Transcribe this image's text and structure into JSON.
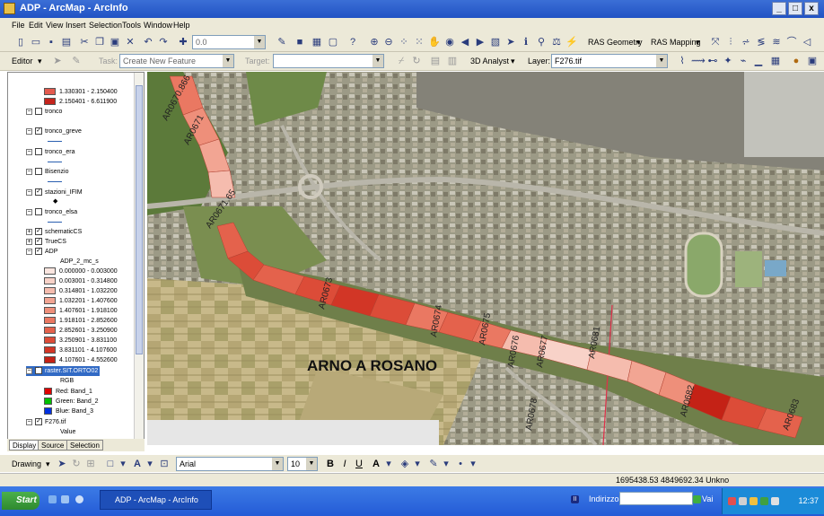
{
  "window": {
    "title": "ADP - ArcMap - ArcInfo",
    "controls": [
      "_",
      "□",
      "x"
    ]
  },
  "menu": [
    "File",
    "Edit",
    "View",
    "Insert",
    "Selection",
    "Tools",
    "Window",
    "Help"
  ],
  "toolbar1": {
    "scale": "0.0",
    "ras_geometry": "RAS Geometry",
    "ras_mapping": "RAS Mapping"
  },
  "toolbar2": {
    "editor": "Editor",
    "task_label": "Task:",
    "task_value": "Create New Feature",
    "target_label": "Target:",
    "analyst": "3D Analyst",
    "layer_label": "Layer:",
    "layer_value": "F276.tif"
  },
  "toc": {
    "top_classes": [
      {
        "label": "1.330301 - 2.150400",
        "color": "#e35a4e"
      },
      {
        "label": "2.150401 - 6.611900",
        "color": "#c4241c"
      }
    ],
    "layers": [
      {
        "name": "tronco",
        "checked": false
      },
      {
        "name": "tronco_greve",
        "checked": true
      },
      {
        "name": "tronco_era",
        "checked": false
      },
      {
        "name": "Bisenzio",
        "checked": false
      },
      {
        "name": "stazioni_IFIM",
        "checked": true
      },
      {
        "name": "tronco_elsa",
        "checked": false
      },
      {
        "name": "schematicCS",
        "checked": true
      },
      {
        "name": "TrueCS",
        "checked": true
      },
      {
        "name": "ADP",
        "checked": true
      }
    ],
    "adp_field": "ADP_2_mc_s",
    "adp_classes": [
      {
        "label": "0.000000 - 0.003000",
        "color": "#fbe6e0"
      },
      {
        "label": "0.003001 - 0.314800",
        "color": "#f8d2c8"
      },
      {
        "label": "0.314801 - 1.032200",
        "color": "#f5bcae"
      },
      {
        "label": "1.032201 - 1.407600",
        "color": "#f2a593"
      },
      {
        "label": "1.407601 - 1.918100",
        "color": "#ee8f7a"
      },
      {
        "label": "1.918101 - 2.852600",
        "color": "#ea7862"
      },
      {
        "label": "2.852601 - 3.250900",
        "color": "#e4624c"
      },
      {
        "label": "3.250901 - 3.831100",
        "color": "#dc4c38"
      },
      {
        "label": "3.831101 - 4.107600",
        "color": "#d23626"
      },
      {
        "label": "4.107601 - 4.552600",
        "color": "#c42216"
      }
    ],
    "raster_layer": "raster.SIT.ORTO02",
    "rgb_label": "RGB",
    "bands": [
      {
        "label": "Red:",
        "band": "Band_1",
        "color": "#e00000"
      },
      {
        "label": "Green:",
        "band": "Band_2",
        "color": "#00c000"
      },
      {
        "label": "Blue:",
        "band": "Band_3",
        "color": "#0030e0"
      }
    ],
    "tif_layer": "F276.tif",
    "value_label": "Value",
    "tabs": [
      "Display",
      "Source",
      "Selection"
    ]
  },
  "map": {
    "title": "ARNO A ROSANO",
    "section_labels": [
      "AR0670.866",
      "AR0671",
      "AR0671.65",
      "AR0673",
      "AR0674",
      "AR0675",
      "AR0676",
      "AR0677",
      "AR0678",
      "AR0681",
      "AR0682",
      "AR0683"
    ]
  },
  "drawing_toolbar": {
    "drawing": "Drawing",
    "font": "Arial",
    "size": "10",
    "bold": "B",
    "italic": "I",
    "underline": "U"
  },
  "status": {
    "coords": "1695438.53  4849692.34 Unkno"
  },
  "taskbar": {
    "start": "Start",
    "task": "ADP - ArcMap - ArcInfo",
    "address_label": "Indirizzo",
    "go": "Vai",
    "clock": "12:37"
  }
}
